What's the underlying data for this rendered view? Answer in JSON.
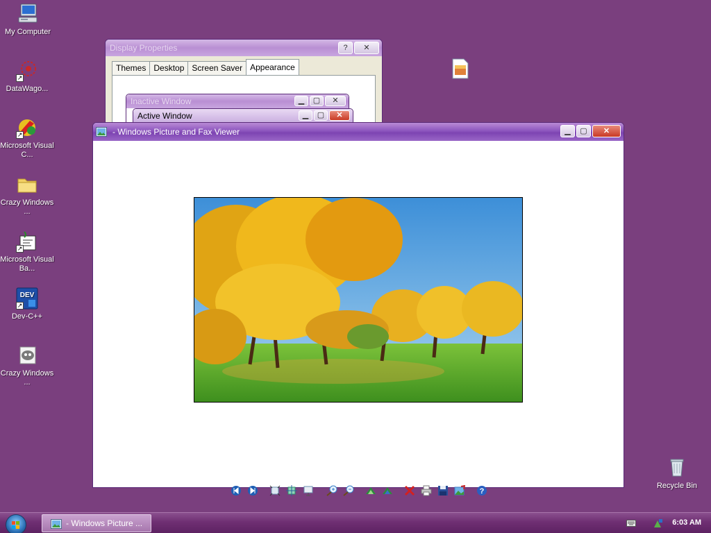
{
  "desktop": {
    "icons": [
      {
        "label": "My Computer",
        "icon": "my-computer-icon"
      },
      {
        "label": "DataWago...",
        "icon": "datawagon-icon"
      },
      {
        "label": "Microsoft Visual C...",
        "icon": "visual-c-icon"
      },
      {
        "label": "Crazy Windows ...",
        "icon": "folder-icon"
      },
      {
        "label": "Microsoft Visual Ba...",
        "icon": "visual-basic-icon"
      },
      {
        "label": "Dev-C++",
        "icon": "dev-cpp-icon"
      },
      {
        "label": "Crazy Windows ...",
        "icon": "raccoon-icon"
      },
      {
        "label": "Recycle Bin",
        "icon": "recycle-bin-icon"
      }
    ]
  },
  "display_properties": {
    "title": "Display Properties",
    "help_glyph": "?",
    "close_glyph": "✕",
    "tabs": [
      "Themes",
      "Desktop",
      "Screen Saver",
      "Appearance"
    ],
    "active_tab": "Appearance",
    "preview": {
      "inactive_title": "Inactive Window",
      "active_title": "Active Window"
    }
  },
  "viewer": {
    "title": "- Windows Picture and Fax Viewer",
    "toolbar": [
      {
        "name": "previous-image-icon",
        "color": "#1e5fb5"
      },
      {
        "name": "next-image-icon",
        "color": "#1e5fb5"
      },
      {
        "name": "best-fit-icon",
        "color": "#6a8fb0"
      },
      {
        "name": "actual-size-icon",
        "color": "#2a8f6a"
      },
      {
        "name": "slideshow-icon",
        "color": "#6a8fb0"
      },
      {
        "name": "zoom-in-icon",
        "color": "#3a7fc8"
      },
      {
        "name": "zoom-out-icon",
        "color": "#3a7fc8"
      },
      {
        "name": "rotate-clockwise-icon",
        "color": "#2c8c3c"
      },
      {
        "name": "rotate-counterclockwise-icon",
        "color": "#2c8c3c"
      },
      {
        "name": "delete-icon",
        "color": "#d42020"
      },
      {
        "name": "print-icon",
        "color": "#808080"
      },
      {
        "name": "save-icon",
        "color": "#2a4f9a"
      },
      {
        "name": "edit-icon",
        "color": "#3c7cc8"
      },
      {
        "name": "help-icon",
        "color": "#2a5fc0"
      }
    ]
  },
  "taskbar": {
    "task_label": "- Windows Picture ...",
    "clock": "6:03 AM"
  },
  "colors": {
    "desktop": "#7a3f7e",
    "title_active": "#7d44b2"
  }
}
